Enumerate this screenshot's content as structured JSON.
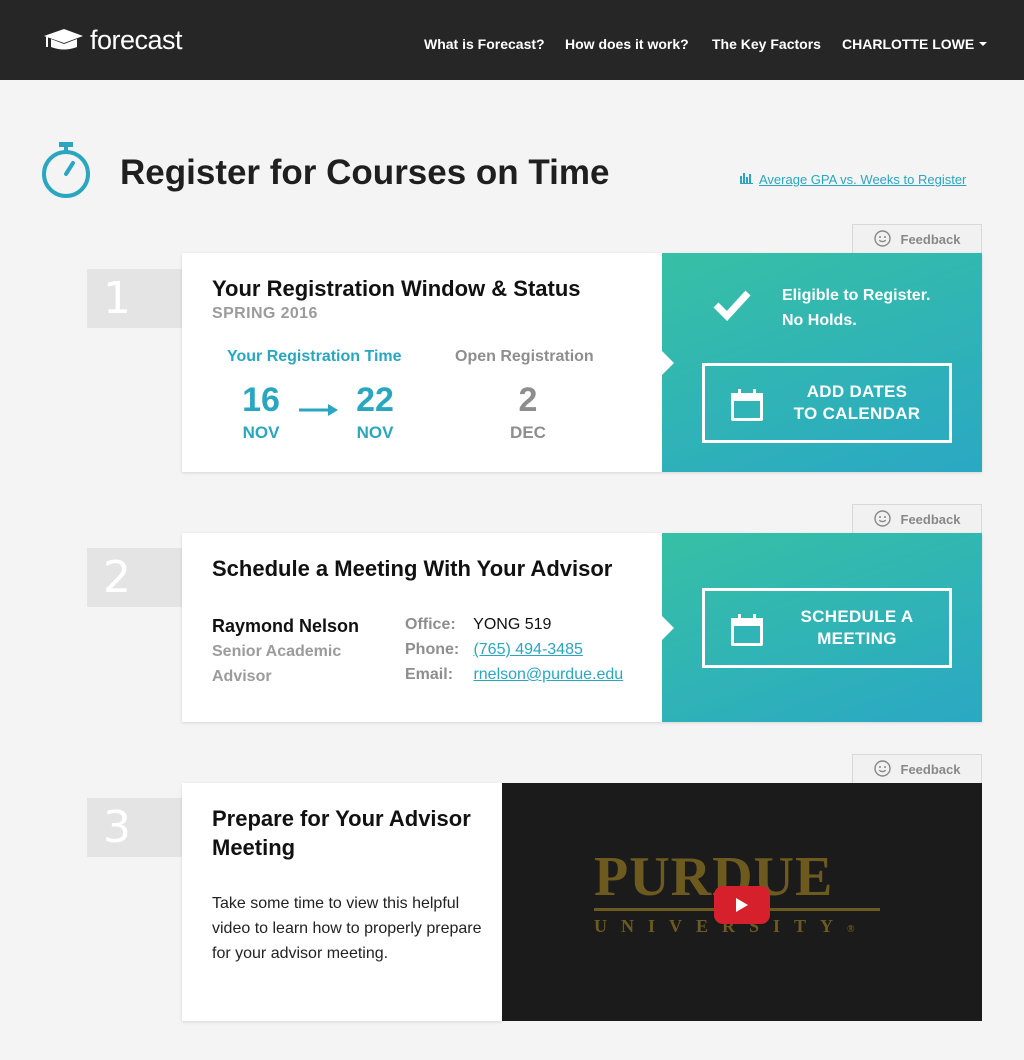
{
  "header": {
    "logo_text": "forecast",
    "nav": [
      {
        "label": "What is Forecast?"
      },
      {
        "label": "How does it work?"
      },
      {
        "label": "The Key Factors"
      }
    ],
    "user": "CHARLOTTE LOWE"
  },
  "page": {
    "title": "Register for Courses on Time",
    "chart_link": "Average GPA vs. Weeks to Register"
  },
  "feedback_label": "Feedback",
  "step1": {
    "number": "1",
    "title": "Your Registration Window & Status",
    "semester": "SPRING 2016",
    "reg_time_label": "Your Registration Time",
    "start_day": "16",
    "start_month": "NOV",
    "end_day": "22",
    "end_month": "NOV",
    "open_label": "Open Registration",
    "open_day": "2",
    "open_month": "DEC",
    "status_line1": "Eligible to Register.",
    "status_line2": "No Holds.",
    "cta_line1": "ADD DATES",
    "cta_line2": "TO CALENDAR"
  },
  "step2": {
    "number": "2",
    "title": "Schedule a Meeting With Your Advisor",
    "advisor_name": "Raymond Nelson",
    "advisor_role": "Senior Academic Advisor",
    "office_label": "Office:",
    "office_value": "YONG 519",
    "phone_label": "Phone:",
    "phone_value": "(765) 494-3485",
    "email_label": "Email:",
    "email_value": "rnelson@purdue.edu",
    "cta_line1": "SCHEDULE A",
    "cta_line2": "MEETING"
  },
  "step3": {
    "number": "3",
    "title_line1": "Prepare for Your Advisor",
    "title_line2": "Meeting",
    "body": "Take some time to view this helpful video to learn how to properly prepare for your advisor meeting.",
    "video_logo_main": "PURDUE",
    "video_logo_sub": "UNIVERSITY",
    "video_logo_mark": "®"
  },
  "icons": {
    "logo": "mortarboard-icon",
    "title": "stopwatch-icon",
    "chart_link": "bar-chart-icon",
    "feedback": "smiley-icon",
    "status": "checkmark-icon",
    "calendar": "calendar-icon",
    "arrow": "arrow-right-icon",
    "play": "play-icon"
  },
  "colors": {
    "header_bg": "#262626",
    "accent": "#2aa6c0",
    "gradient_start": "#37c0a5",
    "gradient_end": "#2aa8c4",
    "purdue_gold": "#6d5a1e",
    "youtube_red": "#d6202b"
  }
}
